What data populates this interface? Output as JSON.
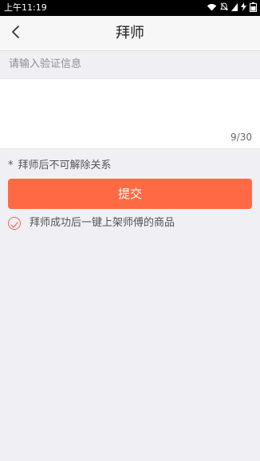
{
  "status_bar": {
    "time": "上午11:19"
  },
  "nav": {
    "title": "拜师"
  },
  "form": {
    "label": "请输入验证信息",
    "textarea_value": "",
    "char_count": "9/30"
  },
  "notice": {
    "asterisk": "*",
    "text": "拜师后不可解除关系"
  },
  "submit": {
    "label": "提交"
  },
  "option": {
    "label": "拜师成功后一键上架师傅的商品",
    "checked": true
  },
  "colors": {
    "accent": "#ff6a45",
    "check": "#e36b58",
    "background": "#efeff4"
  },
  "icons": [
    "wifi-icon",
    "mute-icon",
    "signal-icon",
    "charging-icon",
    "back-arrow-icon",
    "check-icon"
  ]
}
